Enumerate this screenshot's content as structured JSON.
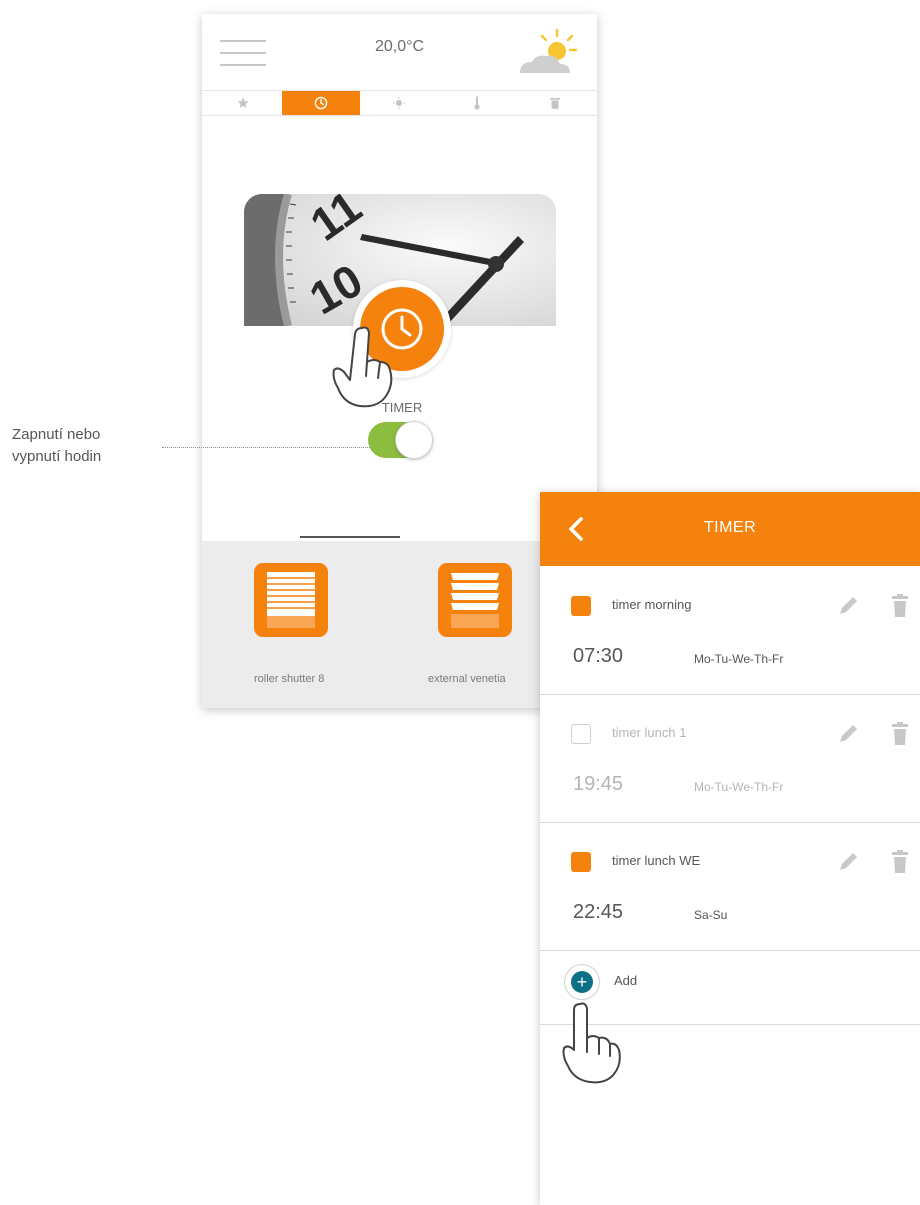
{
  "phone_main": {
    "header": {
      "temperature": "20,0°C",
      "menu_icon": "hamburger-menu-icon",
      "weather_icon": "sun-cloud-icon"
    },
    "tabs": [
      {
        "icon": "star-icon",
        "active": false
      },
      {
        "icon": "clock-icon",
        "active": true
      },
      {
        "icon": "light-icon",
        "active": false
      },
      {
        "icon": "thermometer-icon",
        "active": false
      },
      {
        "icon": "trash-icon",
        "active": false
      }
    ],
    "timer": {
      "label": "TIMER",
      "toggle_on": true,
      "card_image": "clock-face-photo"
    },
    "devices": [
      {
        "label": "roller shutter 8",
        "icon": "roller-shutter-icon"
      },
      {
        "label": "external venetia",
        "icon": "external-venetian-blind-icon"
      }
    ]
  },
  "annotation": {
    "line1": "Zapnutí nebo",
    "line2": "vypnutí hodin"
  },
  "phone_timer": {
    "title": "TIMER",
    "back_icon": "chevron-left-icon",
    "timers": [
      {
        "name": "timer morning",
        "time": "07:30",
        "days": "Mo-Tu-We-Th-Fr",
        "enabled": true
      },
      {
        "name": "timer lunch 1",
        "time": "19:45",
        "days": "Mo-Tu-We-Th-Fr",
        "enabled": false
      },
      {
        "name": "timer lunch WE",
        "time": "22:45",
        "days": "Sa-Su",
        "enabled": true
      }
    ],
    "add_label": "Add",
    "add_icon": "plus-icon"
  },
  "colors": {
    "accent": "#f5820d",
    "toggle_on": "#8cbd3f",
    "add_button": "#0b6f86"
  }
}
